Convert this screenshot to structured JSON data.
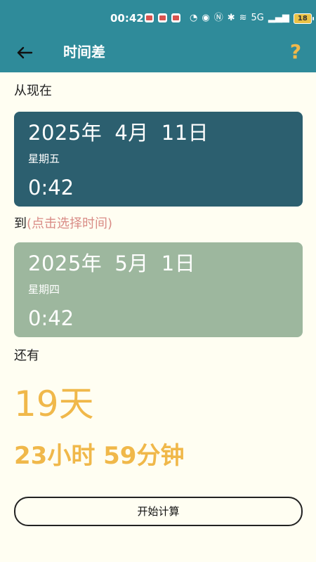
{
  "status_bar": {
    "time": "00:42",
    "network": "5G",
    "battery": "18"
  },
  "header": {
    "title": "时间差"
  },
  "from": {
    "label": "从现在",
    "year": "2025年",
    "month": "4月",
    "day": "11日",
    "weekday": "星期五",
    "time": "0:42"
  },
  "to": {
    "label": "到",
    "hint": "(点击选择时间)",
    "year": "2025年",
    "month": "5月",
    "day": "1日",
    "weekday": "星期四",
    "time": "0:42"
  },
  "result": {
    "label": "还有",
    "days": "19天",
    "hours_minutes": "23小时 59分钟"
  },
  "actions": {
    "calculate_label": "开始计算"
  },
  "colors": {
    "header": "#2f8b9a",
    "start_card": "#2c5f6f",
    "end_card": "#9db79e",
    "accent": "#f0b84a",
    "hint": "#d98c86",
    "background": "#fffef2"
  }
}
